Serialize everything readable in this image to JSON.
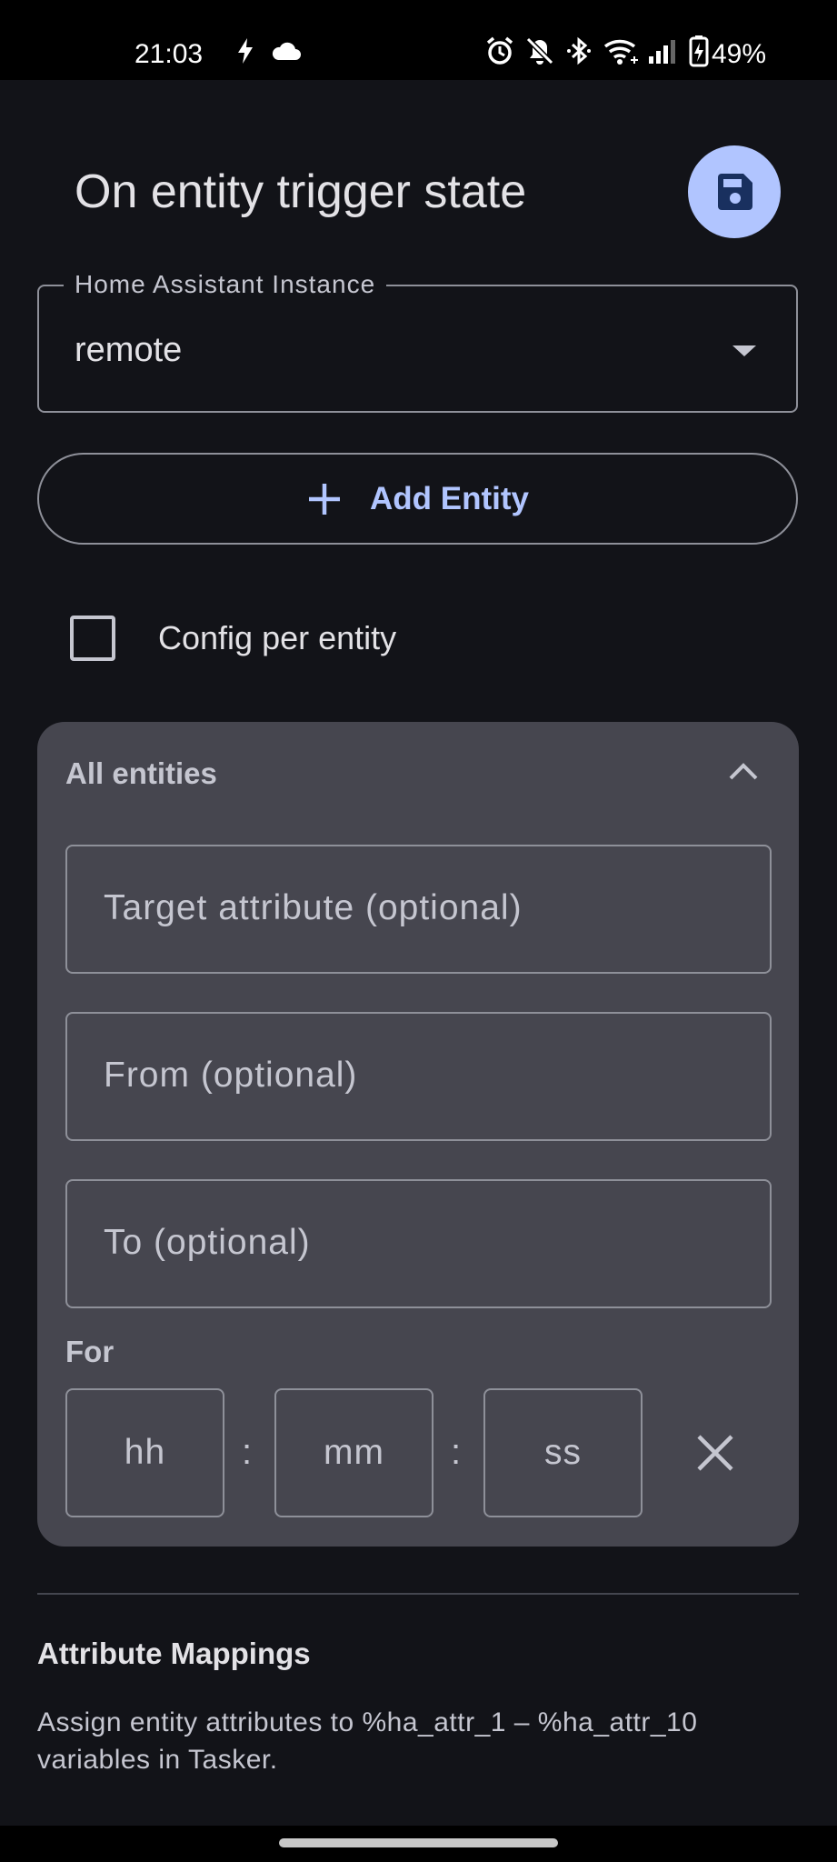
{
  "status_bar": {
    "time": "21:03",
    "battery": "49%",
    "icons": [
      "flash-icon",
      "cloud-icon",
      "alarm-icon",
      "notifications-off-icon",
      "bluetooth-icon",
      "wifi-icon",
      "signal-icon",
      "battery-charging-icon"
    ]
  },
  "header": {
    "title": "On entity trigger state",
    "save_icon": "save-icon"
  },
  "instance": {
    "label": "Home Assistant Instance",
    "value": "remote"
  },
  "add_entity": {
    "label": "Add Entity"
  },
  "config_per_entity": {
    "label": "Config per entity",
    "checked": false
  },
  "all_entities": {
    "title": "All entities",
    "target_attribute_placeholder": "Target attribute (optional)",
    "from_placeholder": "From (optional)",
    "to_placeholder": "To (optional)",
    "for_label": "For",
    "hh_placeholder": "hh",
    "mm_placeholder": "mm",
    "ss_placeholder": "ss",
    "separator": ":"
  },
  "attribute_mappings": {
    "title": "Attribute Mappings",
    "description": "Assign entity attributes to %ha_attr_1 – %ha_attr_10 variables in Tasker."
  },
  "colors": {
    "background": "#121318",
    "accent": "#b1c5ff",
    "card": "#46464f",
    "outline": "#8e9099"
  }
}
